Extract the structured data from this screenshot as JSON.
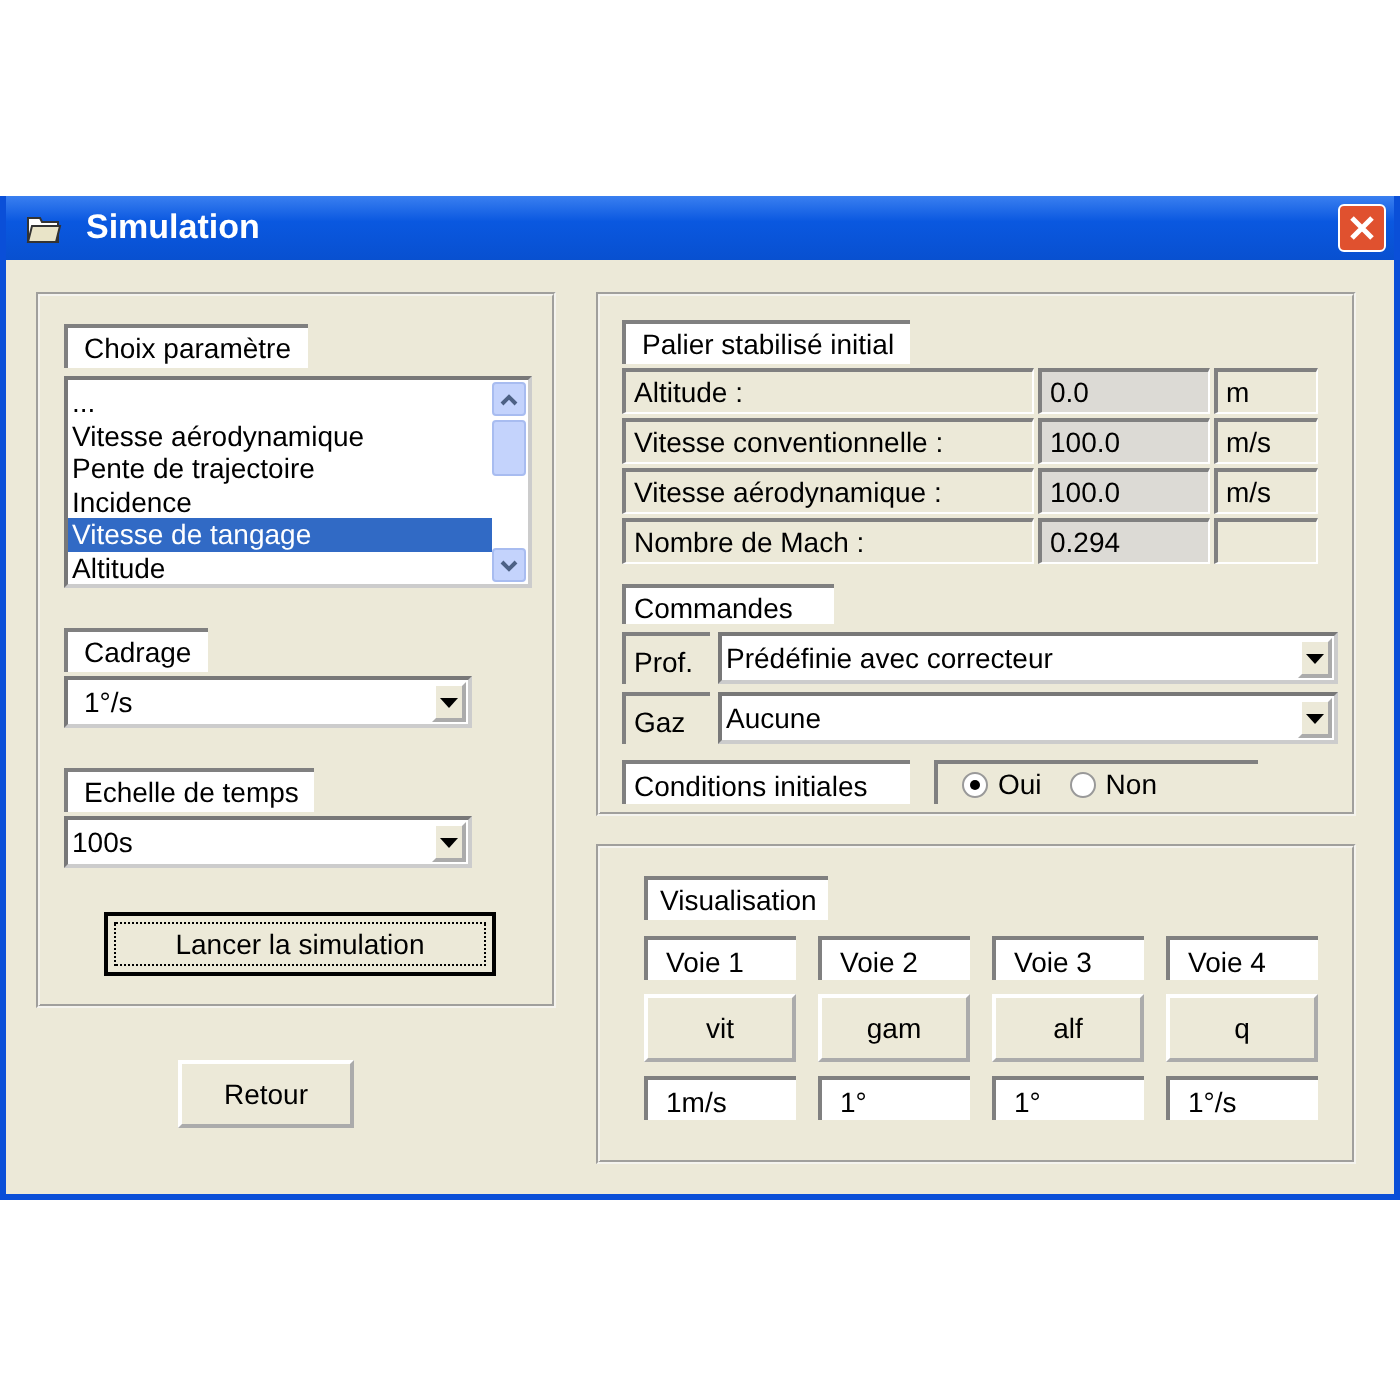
{
  "window": {
    "title": "Simulation"
  },
  "parameter_choice": {
    "label": "Choix paramètre",
    "items": [
      {
        "label": "...",
        "selected": false
      },
      {
        "label": "Vitesse aérodynamique",
        "selected": false
      },
      {
        "label": "Pente de trajectoire",
        "selected": false
      },
      {
        "label": "Incidence",
        "selected": false
      },
      {
        "label": "Vitesse de tangage",
        "selected": true
      },
      {
        "label": "Altitude",
        "selected": false
      }
    ]
  },
  "framing": {
    "label": "Cadrage",
    "value": "1°/s"
  },
  "time_scale": {
    "label": "Echelle de temps",
    "value": "100s"
  },
  "launch_button": "Lancer la simulation",
  "back_button": "Retour",
  "initial_level_flight": {
    "title": "Palier stabilisé initial",
    "rows": [
      {
        "label": "Altitude :",
        "value": "0.0",
        "unit": "m"
      },
      {
        "label": "Vitesse conventionnelle :",
        "value": "100.0",
        "unit": "m/s"
      },
      {
        "label": "Vitesse aérodynamique :",
        "value": "100.0",
        "unit": "m/s"
      },
      {
        "label": "Nombre de Mach :",
        "value": "0.294"
      }
    ]
  },
  "commands": {
    "title": "Commandes",
    "controls": [
      {
        "label": "Prof.",
        "value": "Prédéfinie avec correcteur"
      },
      {
        "label": "Gaz",
        "value": "Aucune"
      }
    ]
  },
  "initial_conditions": {
    "label": "Conditions initiales",
    "options": [
      {
        "label": "Oui",
        "selected": true
      },
      {
        "label": "Non",
        "selected": false
      }
    ]
  },
  "visualisation": {
    "title": "Visualisation",
    "channels": [
      {
        "label": "Voie 1",
        "variable": "vit",
        "scale": "1m/s"
      },
      {
        "label": "Voie 2",
        "variable": "gam",
        "scale": "1°"
      },
      {
        "label": "Voie 3",
        "variable": "alf",
        "scale": "1°"
      },
      {
        "label": "Voie 4",
        "variable": "q",
        "scale": "1°/s"
      }
    ]
  }
}
